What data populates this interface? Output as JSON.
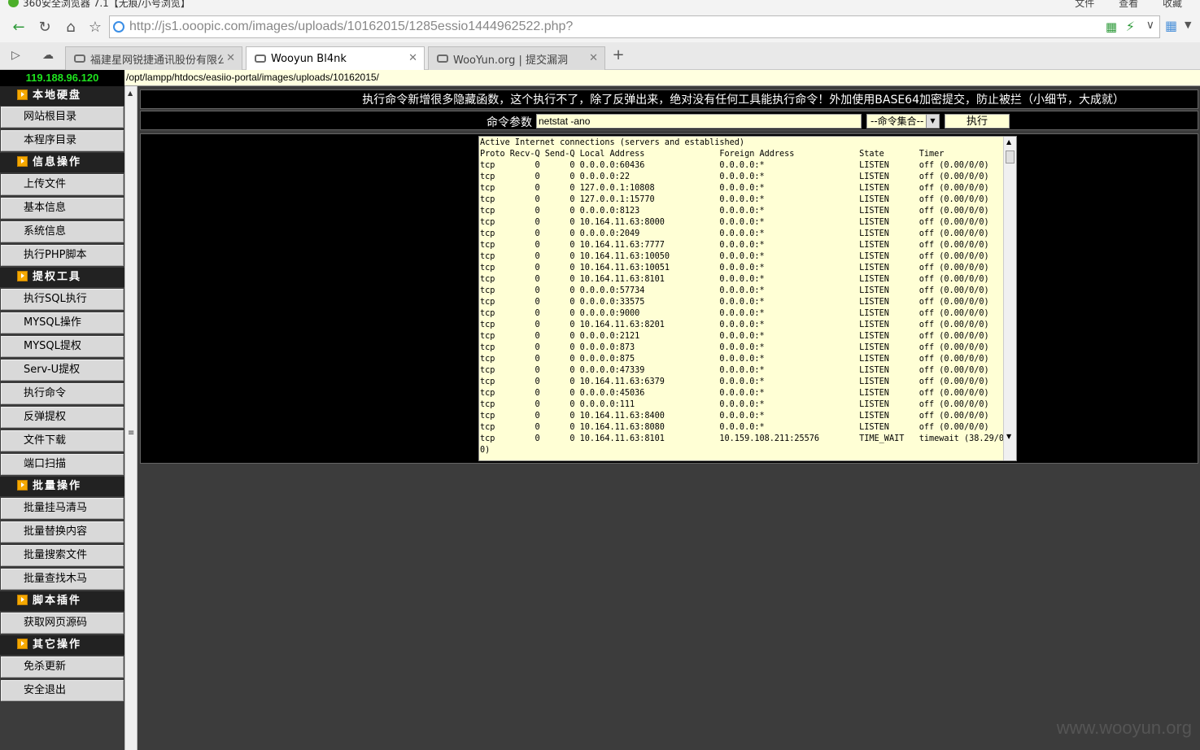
{
  "browser": {
    "title": "360安全浏览器 7.1【无痕/小号浏览】",
    "menus": [
      "文件",
      "查看",
      "收藏"
    ],
    "url": "http://js1.ooopic.com/images/uploads/10162015/1285essio1444962522.php?",
    "tabs": [
      {
        "label": "福建星网锐捷通讯股份有限公司"
      },
      {
        "label": "Wooyun Bl4nk"
      },
      {
        "label": "WooYun.org | 提交漏洞"
      }
    ]
  },
  "page": {
    "ip": "119.188.96.120",
    "path": "/opt/lampp/htdocs/easiio-portal/images/uploads/10162015/",
    "notice": "执行命令新增很多隐藏函数，这个执行不了，除了反弹出来，绝对没有任何工具能执行命令！外加使用BASE64加密提交，防止被拦（小细节，大成就）",
    "cmd_label": "命令参数",
    "cmd_value": "netstat -ano",
    "cmd_select": "--命令集合--",
    "exec_label": "执行",
    "output": "Active Internet connections (servers and established)\nProto Recv-Q Send-Q Local Address               Foreign Address             State       Timer\ntcp        0      0 0.0.0.0:60436               0.0.0.0:*                   LISTEN      off (0.00/0/0)\ntcp        0      0 0.0.0.0:22                  0.0.0.0:*                   LISTEN      off (0.00/0/0)\ntcp        0      0 127.0.0.1:10808             0.0.0.0:*                   LISTEN      off (0.00/0/0)\ntcp        0      0 127.0.0.1:15770             0.0.0.0:*                   LISTEN      off (0.00/0/0)\ntcp        0      0 0.0.0.0:8123                0.0.0.0:*                   LISTEN      off (0.00/0/0)\ntcp        0      0 10.164.11.63:8000           0.0.0.0:*                   LISTEN      off (0.00/0/0)\ntcp        0      0 0.0.0.0:2049                0.0.0.0:*                   LISTEN      off (0.00/0/0)\ntcp        0      0 10.164.11.63:7777           0.0.0.0:*                   LISTEN      off (0.00/0/0)\ntcp        0      0 10.164.11.63:10050          0.0.0.0:*                   LISTEN      off (0.00/0/0)\ntcp        0      0 10.164.11.63:10051          0.0.0.0:*                   LISTEN      off (0.00/0/0)\ntcp        0      0 10.164.11.63:8101           0.0.0.0:*                   LISTEN      off (0.00/0/0)\ntcp        0      0 0.0.0.0:57734               0.0.0.0:*                   LISTEN      off (0.00/0/0)\ntcp        0      0 0.0.0.0:33575               0.0.0.0:*                   LISTEN      off (0.00/0/0)\ntcp        0      0 0.0.0.0:9000                0.0.0.0:*                   LISTEN      off (0.00/0/0)\ntcp        0      0 10.164.11.63:8201           0.0.0.0:*                   LISTEN      off (0.00/0/0)\ntcp        0      0 0.0.0.0:2121                0.0.0.0:*                   LISTEN      off (0.00/0/0)\ntcp        0      0 0.0.0.0:873                 0.0.0.0:*                   LISTEN      off (0.00/0/0)\ntcp        0      0 0.0.0.0:875                 0.0.0.0:*                   LISTEN      off (0.00/0/0)\ntcp        0      0 0.0.0.0:47339               0.0.0.0:*                   LISTEN      off (0.00/0/0)\ntcp        0      0 10.164.11.63:6379           0.0.0.0:*                   LISTEN      off (0.00/0/0)\ntcp        0      0 0.0.0.0:45036               0.0.0.0:*                   LISTEN      off (0.00/0/0)\ntcp        0      0 0.0.0.0:111                 0.0.0.0:*                   LISTEN      off (0.00/0/0)\ntcp        0      0 10.164.11.63:8400           0.0.0.0:*                   LISTEN      off (0.00/0/0)\ntcp        0      0 10.164.11.63:8080           0.0.0.0:*                   LISTEN      off (0.00/0/0)\ntcp        0      0 10.164.11.63:8101           10.159.108.211:25576        TIME_WAIT   timewait (38.29/0/\n0)",
    "watermark": "www.wooyun.org"
  },
  "sidebar": {
    "sections": [
      {
        "title": "本地硬盘",
        "items": [
          "网站根目录",
          "本程序目录"
        ]
      },
      {
        "title": "信息操作",
        "items": [
          "上传文件",
          "基本信息",
          "系统信息",
          "执行PHP脚本"
        ]
      },
      {
        "title": "提权工具",
        "items": [
          "执行SQL执行",
          "MYSQL操作",
          "MYSQL提权",
          "Serv-U提权",
          "执行命令",
          "反弹提权",
          "文件下载",
          "端口扫描"
        ]
      },
      {
        "title": "批量操作",
        "items": [
          "批量挂马清马",
          "批量替换内容",
          "批量搜索文件",
          "批量查找木马"
        ]
      },
      {
        "title": "脚本插件",
        "items": [
          "获取网页源码"
        ]
      },
      {
        "title": "其它操作",
        "items": [
          "免杀更新",
          "安全退出"
        ]
      }
    ]
  }
}
